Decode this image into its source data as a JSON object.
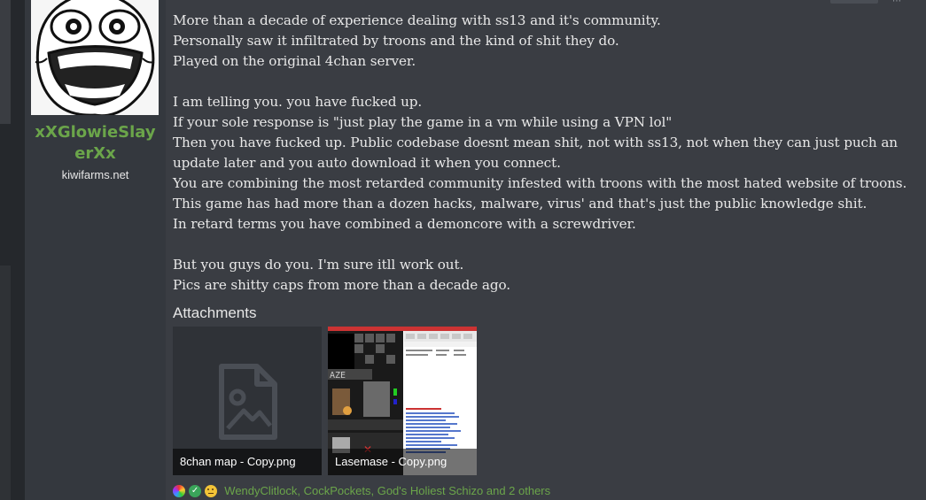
{
  "user": {
    "username": "xXGlowieSlayerXx",
    "title": "kiwifarms.net"
  },
  "post": {
    "lines": [
      "More than a decade of experience dealing with ss13 and it's community.",
      "Personally saw it infiltrated by troons and the kind of shit they do.",
      "Played on the original 4chan server.",
      "I am telling you. you have fucked up.",
      "If your sole response is \"just play the game in a vm while using a VPN lol\"",
      "Then you have fucked up. Public codebase doesnt mean shit, not with ss13, not when they can just puch an update later and you auto download it when you connect.",
      "You are combining the most retarded community infested with troons with the most hated website of troons.",
      "This game has had more than a dozen hacks, malware, virus' and that's just the public knowledge shit.",
      "In retard terms you have combined a demoncore with a screwdriver.",
      "But you guys do you. I'm sure itll work out.",
      "Pics are shitty caps from more than a decade ago."
    ]
  },
  "attachments": {
    "heading": "Attachments",
    "items": [
      {
        "filename": "8chan map - Copy.png"
      },
      {
        "filename": "Lasemase - Copy.png"
      }
    ]
  },
  "reactions": {
    "icons": [
      "rainbow-star-icon",
      "check-icon",
      "thinking-face-icon"
    ],
    "text": "WendyClitlock, CockPockets, God's Holiest Schizo and 2 others"
  },
  "colors": {
    "accent_green": "#6ba54a",
    "body_bg": "#3a3d43",
    "user_col_bg": "#34383e",
    "text": "#e8e8e8"
  }
}
